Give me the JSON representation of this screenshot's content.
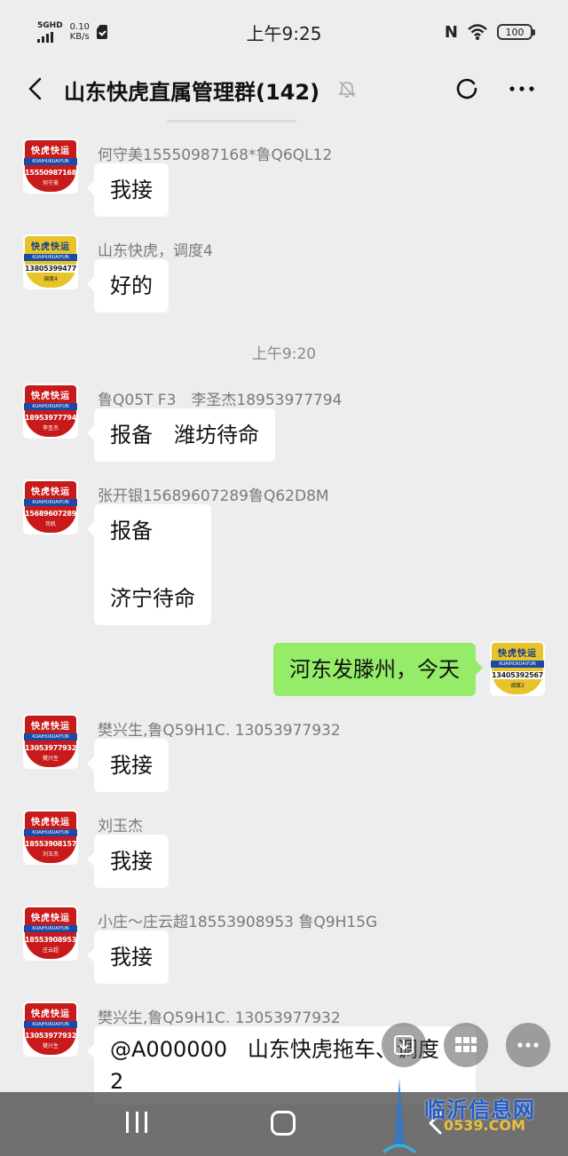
{
  "status_bar": {
    "network": "5GHD",
    "speed_value": "0.10",
    "speed_unit": "KB/s",
    "time": "上午9:25",
    "battery": "100"
  },
  "header": {
    "title": "山东快虎直属管理群(142)"
  },
  "time_divider": "上午9:20",
  "avatar_brand": "快虎快运",
  "avatar_ribbon": "KUAIHUKUAIYUN",
  "messages": [
    {
      "sender": "何守美15550987168*鲁Q6QL12",
      "text": "我接",
      "avatar_phone": "15550987168",
      "avatar_role": "何守美",
      "avatar_style": "red"
    },
    {
      "sender": "山东快虎，调度4",
      "text": "好的",
      "avatar_phone": "13805399477",
      "avatar_role": "调度4",
      "avatar_style": "yellow"
    },
    {
      "sender": "鲁Q05T F3　李圣杰18953977794",
      "text": "报备　潍坊待命",
      "avatar_phone": "18953977794",
      "avatar_role": "李圣杰",
      "avatar_style": "red"
    },
    {
      "sender": "张开银15689607289鲁Q62D8M",
      "text": "报备\n\n济宁待命",
      "avatar_phone": "15689607289",
      "avatar_role": "司机",
      "avatar_style": "red"
    },
    {
      "sender": "",
      "text": "河东发滕州，今天",
      "avatar_phone": "13405392567",
      "avatar_role": "调度2",
      "avatar_style": "yellow",
      "mine": true
    },
    {
      "sender": "樊兴生,鲁Q59H1C. 13053977932",
      "text": "我接",
      "avatar_phone": "13053977932",
      "avatar_role": "樊兴生",
      "avatar_style": "red"
    },
    {
      "sender": "刘玉杰",
      "text": "我接",
      "avatar_phone": "18553908157",
      "avatar_role": "刘玉杰",
      "avatar_style": "red"
    },
    {
      "sender": "小庄～庄云超18553908953 鲁Q9H15G",
      "text": "我接",
      "avatar_phone": "18553908953",
      "avatar_role": "庄云超",
      "avatar_style": "red"
    },
    {
      "sender": "樊兴生,鲁Q59H1C. 13053977932",
      "text": "@A000000   山东快虎拖车、调度\n2",
      "avatar_phone": "13053977932",
      "avatar_role": "樊兴生",
      "avatar_style": "red"
    }
  ],
  "watermark": {
    "site_name": "临沂信息网",
    "url": "0539.COM"
  }
}
